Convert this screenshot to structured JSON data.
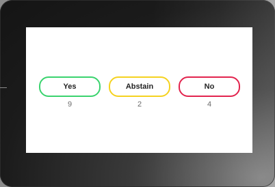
{
  "voting": {
    "options": [
      {
        "label": "Yes",
        "count": "9",
        "color": "#39d36d"
      },
      {
        "label": "Abstain",
        "count": "2",
        "color": "#f5d21f"
      },
      {
        "label": "No",
        "count": "4",
        "color": "#e2234d"
      }
    ]
  },
  "colors": {
    "screen_background": "#ffffff",
    "device_bezel": "#141414",
    "count_text": "#6b6b6b"
  }
}
